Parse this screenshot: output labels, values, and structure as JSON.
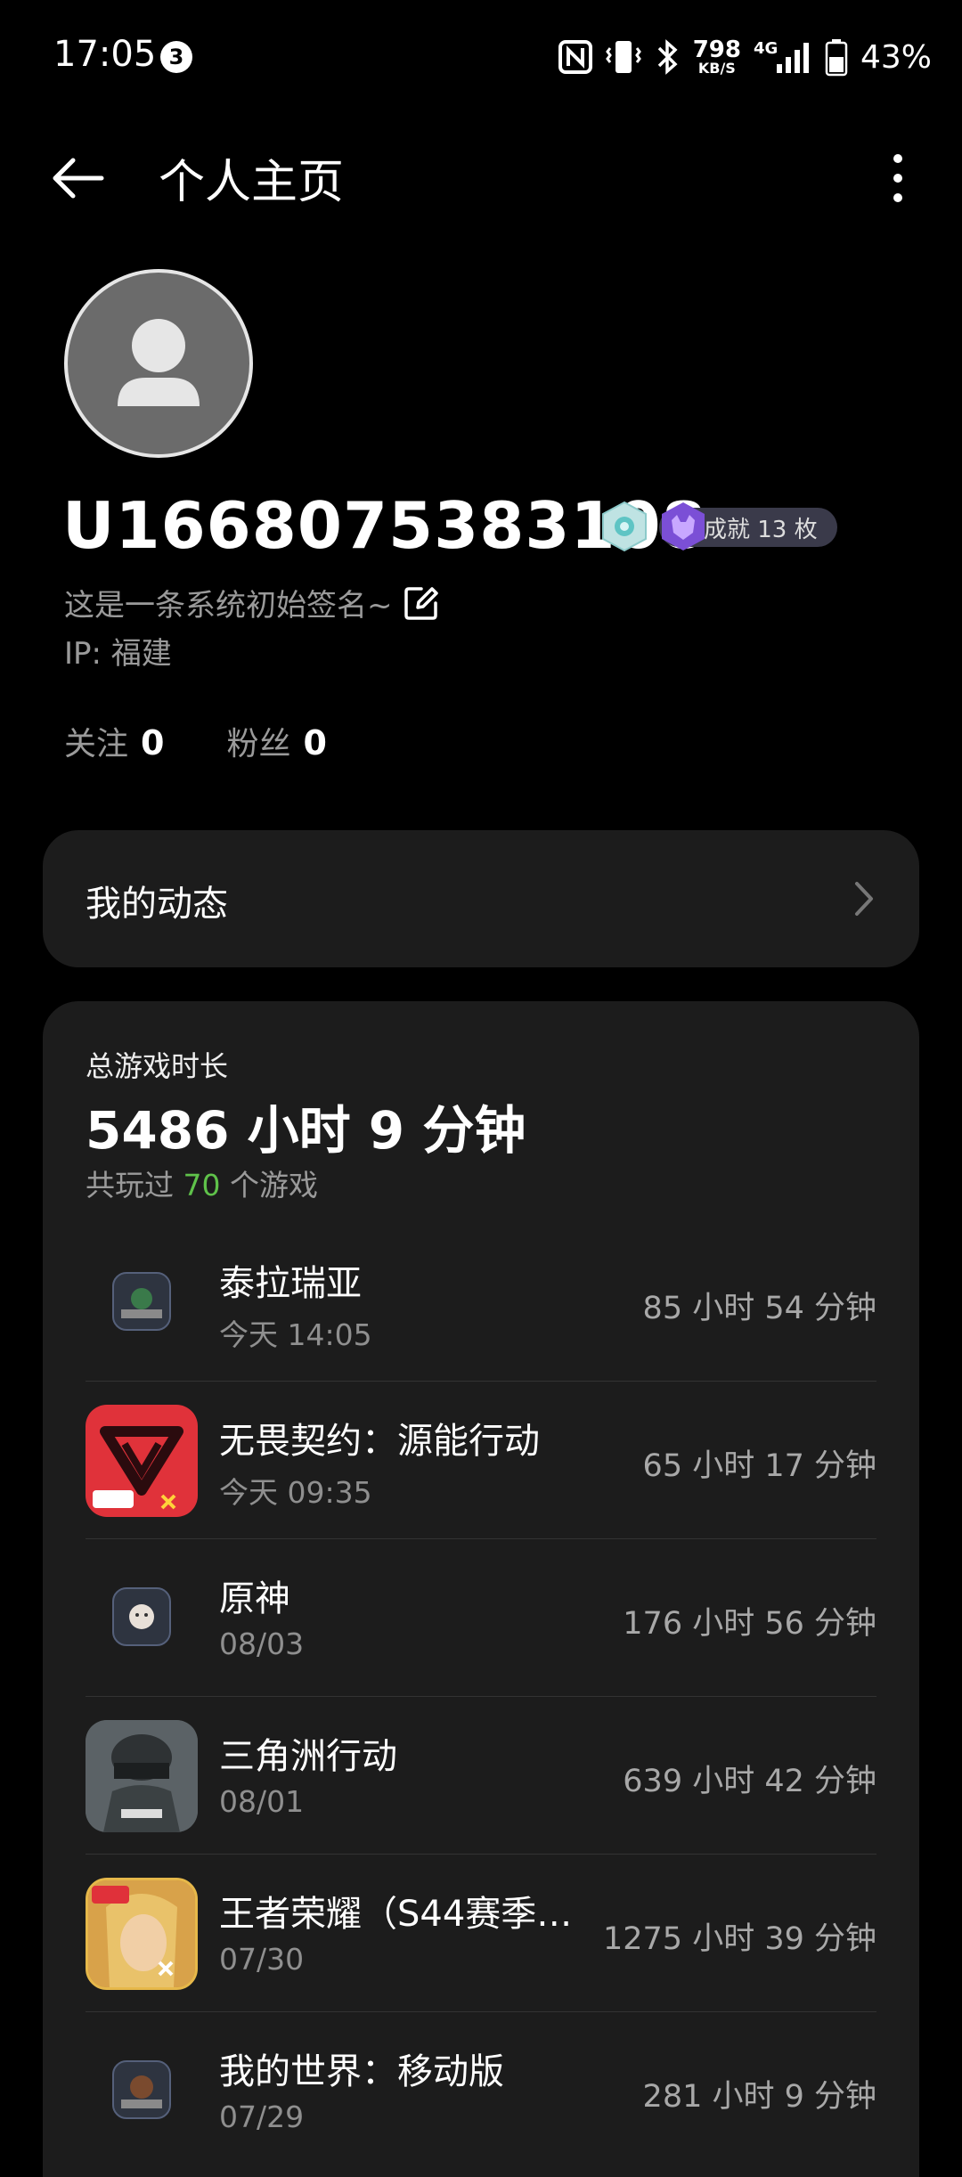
{
  "status_bar": {
    "time": "17:05",
    "notification_count": "3",
    "net_speed_value": "798",
    "net_speed_unit": "KB/S",
    "network": "4G",
    "battery": "43%"
  },
  "header": {
    "title": "个人主页"
  },
  "profile": {
    "username": "U1668075383108",
    "achievement_label": "成就 13 枚",
    "signature": "这是一条系统初始签名~",
    "ip": "IP: 福建",
    "following_label": "关注",
    "following_count": "0",
    "followers_label": "粉丝",
    "followers_count": "0"
  },
  "posts_card": {
    "label": "我的动态"
  },
  "playtime": {
    "label": "总游戏时长",
    "total": "5486 小时 9 分钟",
    "count_prefix": "共玩过",
    "count": "70",
    "count_suffix": "个游戏",
    "games": [
      {
        "name": "泰拉瑞亚",
        "date": "今天 14:05",
        "time": "85 小时 54 分钟"
      },
      {
        "name": "无畏契约：源能行动",
        "date": "今天 09:35",
        "time": "65 小时 17 分钟"
      },
      {
        "name": "原神",
        "date": "08/03",
        "time": "176 小时 56 分钟"
      },
      {
        "name": "三角洲行动",
        "date": "08/01",
        "time": "639 小时 42 分钟"
      },
      {
        "name": "王者荣耀（S44赛季…",
        "date": "07/30",
        "time": "1275 小时 39 分钟"
      },
      {
        "name": "我的世界：移动版",
        "date": "07/29",
        "time": "281 小时 9 分钟"
      }
    ]
  },
  "colors": {
    "background": "#000000",
    "card": "#1c1c1c",
    "accent_green": "#5fc24a",
    "muted_text": "#9a9a9a"
  }
}
